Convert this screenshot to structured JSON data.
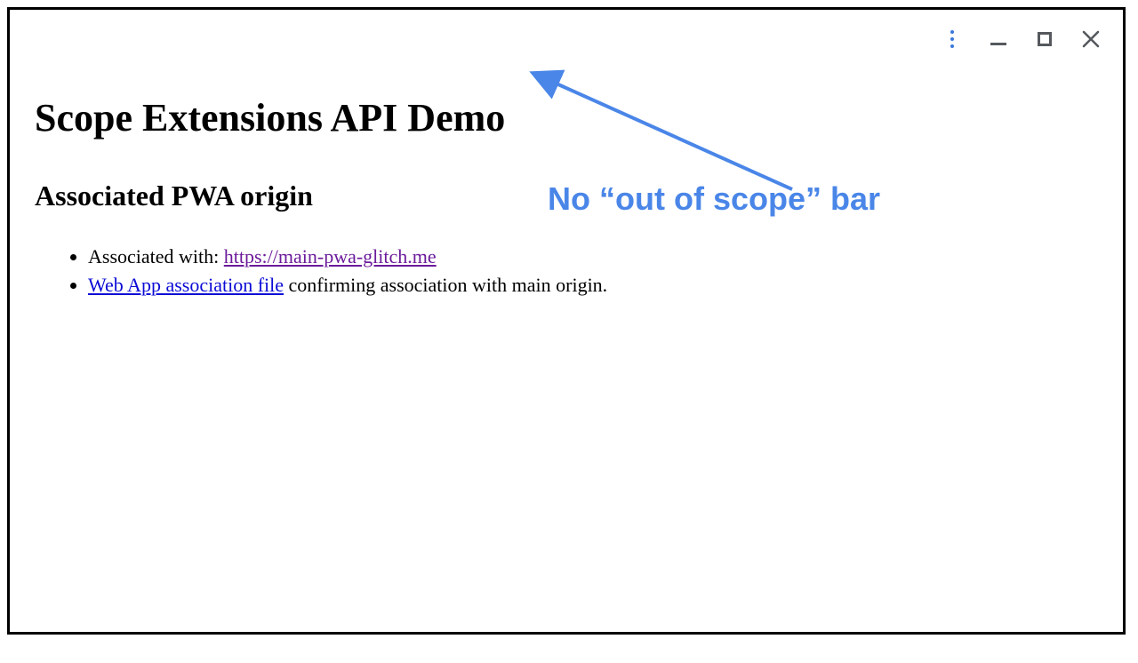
{
  "window": {
    "titlebar": {
      "more_icon": "more-vertical-icon",
      "minimize_icon": "minimize-icon",
      "maximize_icon": "maximize-icon",
      "close_icon": "close-icon"
    }
  },
  "page": {
    "title": "Scope Extensions API Demo",
    "section_title": "Associated PWA origin",
    "items": [
      {
        "prefix": "Associated with: ",
        "link_text": "https://main-pwa-glitch.me",
        "suffix": ""
      },
      {
        "prefix": "",
        "link_text": "Web App association file",
        "suffix": " confirming association with main origin."
      }
    ]
  },
  "annotation": {
    "label": "No “out of scope” bar"
  }
}
